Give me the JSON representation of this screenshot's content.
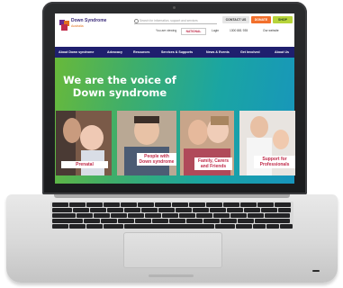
{
  "header": {
    "logo_line1": "Down Syndrome",
    "logo_line2": "Australia",
    "search_placeholder": "Search for information, support and services",
    "contact_label": "CONTACT US",
    "donate_label": "DONATE",
    "shop_label": "SHOP",
    "viewing_label": "You are viewing",
    "region_value": "NATIONAL",
    "login_label": "Login",
    "phone_label": "1300 881 935",
    "website_label": "Our website"
  },
  "nav": {
    "items": [
      "About Down syndrome",
      "Advocacy",
      "Resources",
      "Services & Supports",
      "News & Events",
      "Get Involved",
      "About Us"
    ]
  },
  "hero": {
    "title_line1": "We are the voice of",
    "title_line2": "Down syndrome"
  },
  "cards": [
    {
      "label": "Prenatal"
    },
    {
      "label": "People with Down syndrome"
    },
    {
      "label": "Family, Carers and Friends"
    },
    {
      "label": "Support for Professionals"
    }
  ],
  "colors": {
    "brand_purple": "#3b2b7a",
    "brand_orange": "#e0701f",
    "nav_navy": "#1f1f6e",
    "card_label_red": "#c02b4a",
    "donate_orange": "#f2702c",
    "shop_green": "#b7d43a"
  }
}
